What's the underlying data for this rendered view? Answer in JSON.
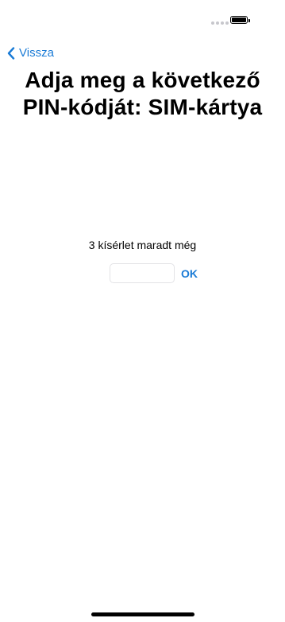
{
  "nav": {
    "back_label": "Vissza"
  },
  "header": {
    "title_line1": "Adja meg a következő",
    "title_line2": "PIN-kódját: SIM-kártya"
  },
  "main": {
    "attempts_text": "3 kísérlet maradt még",
    "pin_input": {
      "value": "",
      "placeholder": ""
    },
    "ok_label": "OK"
  },
  "colors": {
    "accent": "#1a7bd6",
    "background": "#ffffff",
    "text": "#000000"
  },
  "icons": {
    "back": "chevron-left-icon",
    "battery": "battery-icon",
    "signal": "signal-dots-icon"
  }
}
